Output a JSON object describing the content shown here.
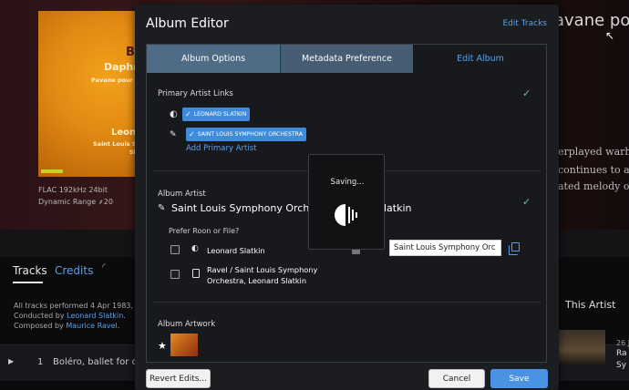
{
  "background": {
    "album_cover": {
      "line1": "B",
      "line2": "Daphni",
      "line3": "Pavane pour un",
      "line4": "Leone",
      "line5": "Saint Louis Symphony",
      "line6": "Sl"
    },
    "format": "FLAC 192kHz 24bit",
    "dynamic_range": "Dynamic Range",
    "dynamic_range_value": "20",
    "title_fragment": "avane po",
    "desc_line1": "erplayed warh",
    "desc_line2": "continues to ap",
    "desc_line3": "ated melody ov",
    "tabs": {
      "tracks": "Tracks",
      "credits": "Credits"
    },
    "performed_line": "All tracks performed 4 Apr 1983, Po",
    "conducted_prefix": "Conducted by ",
    "conducted_link": "Leonard Slatkin",
    "conducted_suffix": ".",
    "composed_prefix": "Composed by ",
    "composed_link": "Maurice Ravel",
    "composed_suffix": ".",
    "this_artist": "This Artist",
    "track_number": "1",
    "track_title": "Boléro, ballet for orc",
    "right_frag1": "26 J",
    "right_frag2": "Ra",
    "right_frag3": "Sy"
  },
  "dialog": {
    "title": "Album Editor",
    "edit_tracks_link": "Edit Tracks",
    "tabs": [
      {
        "label": "Album Options",
        "active": false
      },
      {
        "label": "Metadata Preference",
        "active": false
      },
      {
        "label": "Edit Album",
        "active": true
      }
    ],
    "primary_artist_section": {
      "label": "Primary Artist Links",
      "chips": [
        "LEONARD SLATKIN",
        "SAINT LOUIS SYMPHONY ORCHESTRA"
      ],
      "add_link": "Add Primary Artist"
    },
    "album_artist_section": {
      "label": "Album Artist",
      "value_left": "Saint Louis Symphony Orches",
      "value_right": "latkin",
      "prefer_label": "Prefer Roon or File?",
      "option_roon": "Leonard Slatkin",
      "option_file_line1": "Ravel / Saint Louis Symphony",
      "option_file_line2": "Orchestra, Leonard Slatkin",
      "input_value": "Saint Louis Symphony Orc"
    },
    "artwork_section": {
      "label": "Album Artwork"
    },
    "buttons": {
      "revert": "Revert Edits...",
      "cancel": "Cancel",
      "save": "Save"
    }
  },
  "saving_overlay": {
    "label": "Saving..."
  },
  "colors": {
    "accent": "#4a93e3",
    "link": "#5aa0e8",
    "check": "#5fcf9a",
    "tab_inactive": "#4f6c86"
  }
}
